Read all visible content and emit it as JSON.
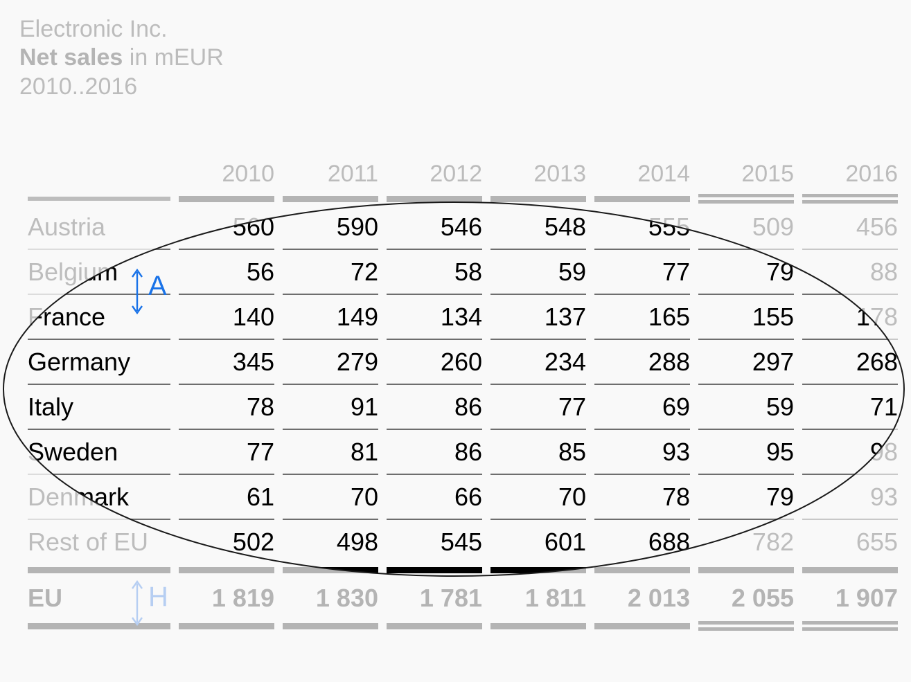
{
  "title": {
    "company": "Electronic Inc.",
    "metric_strong": "Net sales",
    "metric_rest": " in mEUR",
    "period": "2010..2016"
  },
  "table": {
    "label_header": "",
    "columns": [
      "2010",
      "2011",
      "2012",
      "2013",
      "2014",
      "2015",
      "2016"
    ],
    "column_rule_styles": [
      "thick",
      "thick",
      "thick",
      "thick",
      "thick",
      "double",
      "double"
    ],
    "rows": [
      {
        "label": "Austria",
        "values": [
          "560",
          "590",
          "546",
          "548",
          "555",
          "509",
          "456"
        ]
      },
      {
        "label": "Belgium",
        "values": [
          "56",
          "72",
          "58",
          "59",
          "77",
          "79",
          "88"
        ]
      },
      {
        "label": "France",
        "values": [
          "140",
          "149",
          "134",
          "137",
          "165",
          "155",
          "178"
        ]
      },
      {
        "label": "Germany",
        "values": [
          "345",
          "279",
          "260",
          "234",
          "288",
          "297",
          "268"
        ]
      },
      {
        "label": "Italy",
        "values": [
          "78",
          "91",
          "86",
          "77",
          "69",
          "59",
          "71"
        ]
      },
      {
        "label": "Sweden",
        "values": [
          "77",
          "81",
          "86",
          "85",
          "93",
          "95",
          "98"
        ]
      },
      {
        "label": "Denmark",
        "values": [
          "61",
          "70",
          "66",
          "70",
          "78",
          "79",
          "93"
        ]
      },
      {
        "label": "Rest of EU",
        "values": [
          "502",
          "498",
          "545",
          "601",
          "688",
          "782",
          "655"
        ]
      }
    ],
    "total": {
      "label": "EU",
      "values": [
        "1 819",
        "1 830",
        "1 781",
        "1 811",
        "2 013",
        "2 055",
        "1 907"
      ]
    }
  },
  "annotations": {
    "row_height_marker": "A",
    "total_height_marker": "H"
  },
  "colors": {
    "background": "#f9f9f9",
    "muted_text": "#bdbdbd",
    "highlight_text": "#000000",
    "rule": "#b4b4b4",
    "accent_blue": "#1a73e8",
    "accent_blue_faded": "#b6cef2",
    "ellipse_stroke": "#1a1a1a"
  }
}
